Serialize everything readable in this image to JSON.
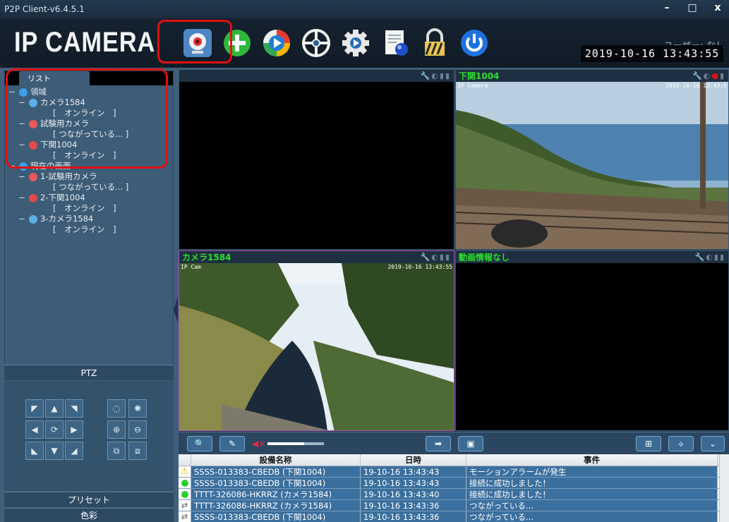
{
  "window": {
    "title": "P2P Client-v6.4.5.1",
    "minimize": "–",
    "maximize": "□",
    "close": "x"
  },
  "header": {
    "logo": "IP CAMERA",
    "user": "ユーザー: なし",
    "datetime": "2019-10-16  13:43:55",
    "toolbar": [
      "camera-icon",
      "add-icon",
      "playback-icon",
      "settings-wheel-icon",
      "gear-icon",
      "log-icon",
      "lock-icon",
      "power-icon"
    ]
  },
  "left": {
    "tab": "リスト",
    "tree": {
      "root1": "領域",
      "cams": [
        {
          "name": "カメラ1584",
          "status": "[　オンライン　]"
        },
        {
          "name": "試験用カメラ",
          "status": "[ つながっている... ]"
        },
        {
          "name": "下関1004",
          "status": "[　オンライン　]"
        }
      ],
      "root2": "現在の画面",
      "screen": [
        {
          "name": "1-試験用カメラ",
          "status": "[ つながっている... ]"
        },
        {
          "name": "2-下関1004",
          "status": "[　オンライン　]"
        },
        {
          "name": "3-カメラ1584",
          "status": "[　オンライン　]"
        }
      ]
    },
    "ptz": "PTZ",
    "preset": "プリセット",
    "color": "色彩"
  },
  "panes": [
    {
      "name": "",
      "osd_left": "",
      "osd_right": ""
    },
    {
      "name": "下関1004",
      "osd_left": "IP Camera",
      "osd_right": "2019-10-16 13:43:5"
    },
    {
      "name": "カメラ1584",
      "osd_left": "IP Cam",
      "osd_right": "2019-10-16 13:43:55"
    },
    {
      "name": "動画情報なし",
      "osd_left": "",
      "osd_right": ""
    }
  ],
  "events": {
    "headers": [
      "設備名称",
      "日時",
      "事件"
    ],
    "rows": [
      {
        "icon": "warning-icon",
        "device": "SSSS-013383-CBEDB (下関1004)",
        "time": "19-10-16 13:43:43",
        "event": "モーションアラームが発生"
      },
      {
        "icon": "ok-icon",
        "device": "SSSS-013383-CBEDB (下関1004)",
        "time": "19-10-16 13:43:43",
        "event": "接続に成功しました！"
      },
      {
        "icon": "ok-icon",
        "device": "TTTT-326086-HKRRZ (カメラ1584)",
        "time": "19-10-16 13:43:40",
        "event": "接続に成功しました！"
      },
      {
        "icon": "link-icon",
        "device": "TTTT-326086-HKRRZ (カメラ1584)",
        "time": "19-10-16 13:43:36",
        "event": "つながっている..."
      },
      {
        "icon": "link-icon",
        "device": "SSSS-013383-CBEDB (下関1004)",
        "time": "19-10-16 13:43:36",
        "event": "つながっている..."
      }
    ]
  },
  "colors": {
    "highlight": "#e01010",
    "pane_label": "#2ee02e",
    "accent": "#3b6f9e"
  },
  "volume_level": 0.65
}
